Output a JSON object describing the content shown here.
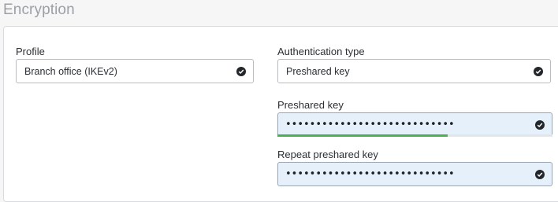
{
  "section": {
    "title": "Encryption"
  },
  "profile": {
    "label": "Profile",
    "value": "Branch office (IKEv2)"
  },
  "auth_type": {
    "label": "Authentication type",
    "value": "Preshared key"
  },
  "psk": {
    "label": "Preshared key",
    "value": "••••••••••••••••••••••••••••",
    "strength": 0.62
  },
  "repeat_psk": {
    "label": "Repeat preshared key",
    "value": "••••••••••••••••••••••••••••"
  },
  "icons": {
    "valid": "check-circle-icon"
  },
  "colors": {
    "strength_fill": "#4caf50",
    "password_bg": "#e6f0fb"
  }
}
